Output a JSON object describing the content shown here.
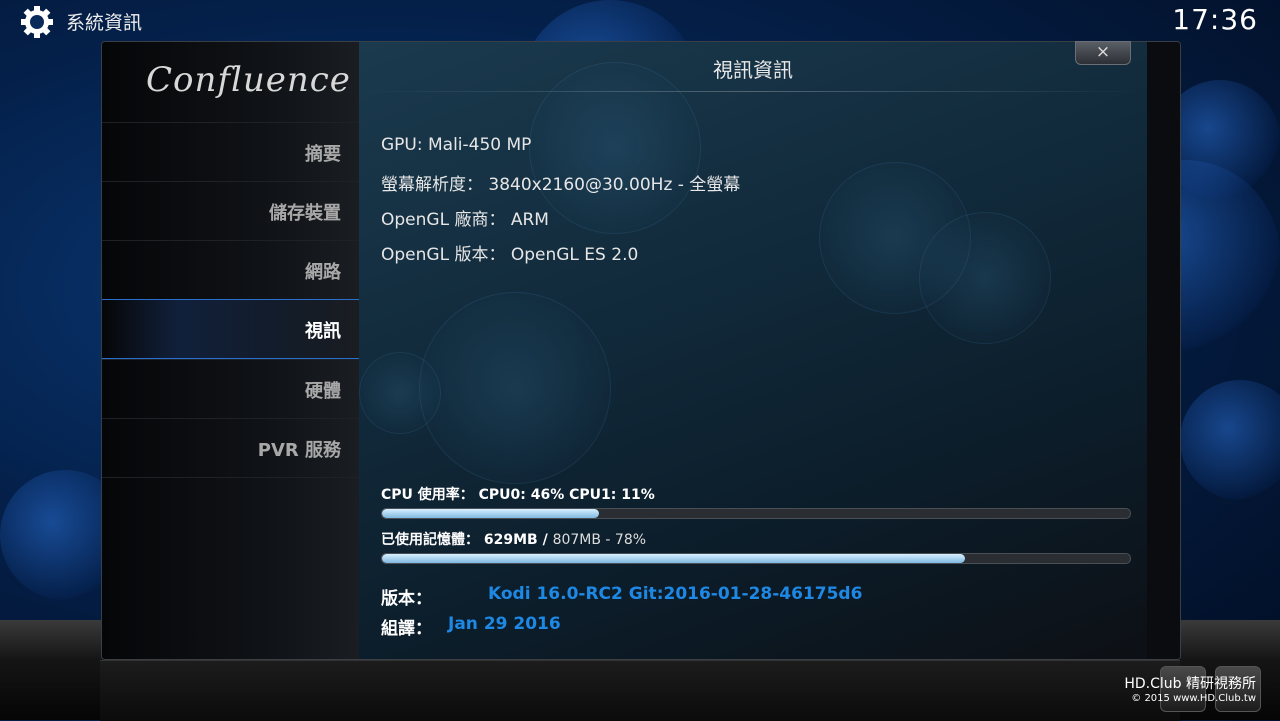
{
  "header": {
    "title": "系統資訊",
    "clock": "17:36",
    "icon": "gear-icon"
  },
  "sidebar": {
    "logo": "Confluence",
    "items": [
      {
        "label": "摘要",
        "active": false
      },
      {
        "label": "儲存裝置",
        "active": false
      },
      {
        "label": "網路",
        "active": false
      },
      {
        "label": "視訊",
        "active": true
      },
      {
        "label": "硬體",
        "active": false
      },
      {
        "label": "PVR 服務",
        "active": false
      }
    ]
  },
  "dialog": {
    "title": "視訊資訊",
    "close_label": "×"
  },
  "info": [
    "GPU: Mali-450 MP",
    "螢幕解析度： 3840x2160@30.00Hz - 全螢幕",
    "OpenGL 廠商： ARM",
    "OpenGL 版本： OpenGL ES 2.0"
  ],
  "cpu": {
    "label": "CPU 使用率： CPU0:  46% CPU1:  11%",
    "percent": 29
  },
  "memory": {
    "label": "已使用記憶體： 629MB / ",
    "sub": "807MB - 78%",
    "percent": 78
  },
  "version": {
    "label": "版本：",
    "value": "Kodi 16.0-RC2 Git:2016-01-28-46175d6"
  },
  "build": {
    "label": "組譯：",
    "value": "Jan 29 2016"
  },
  "watermark": {
    "line1": "HD.Club 精研視務所",
    "line2": "© 2015  www.HD.Club.tw"
  },
  "colors": {
    "accent": "#1e88e5",
    "bar_fill": "#a8d4f0"
  }
}
